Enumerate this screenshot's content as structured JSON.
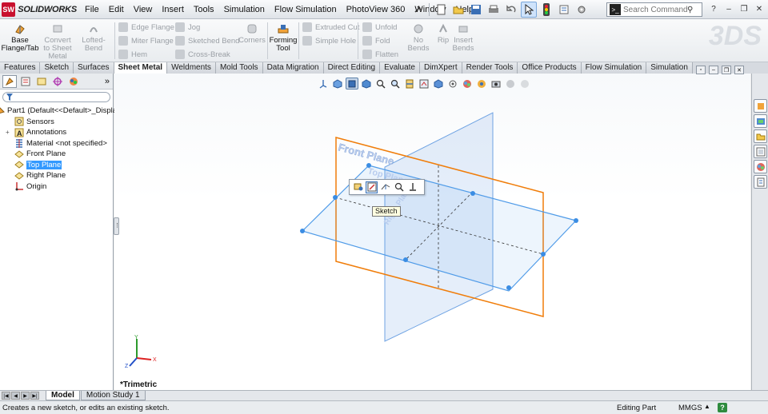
{
  "app": {
    "logo_badge": "SW",
    "logo_name": "SOLIDWORKS",
    "menus": [
      "File",
      "Edit",
      "View",
      "Insert",
      "Tools",
      "Simulation",
      "Flow Simulation",
      "PhotoView 360",
      "Window",
      "Help"
    ],
    "search_placeholder": "Search Commands",
    "watermark": "3DS"
  },
  "ribbon": {
    "base_flange": "Base Flange/Tab",
    "convert": "Convert to Sheet Metal",
    "lofted_bend": "Lofted-Bend",
    "edge_flange": "Edge Flange",
    "miter_flange": "Miter Flange",
    "hem": "Hem",
    "jog": "Jog",
    "sketched_bend": "Sketched Bend",
    "cross_break": "Cross-Break",
    "corners": "Corners",
    "forming_tool": "Forming Tool",
    "extruded_cut": "Extruded Cut",
    "simple_hole": "Simple Hole",
    "unfold": "Unfold",
    "fold": "Fold",
    "flatten": "Flatten",
    "no_bends": "No Bends",
    "rip": "Rip",
    "insert_bends": "Insert Bends"
  },
  "tabs": [
    {
      "label": "Features",
      "active": false
    },
    {
      "label": "Sketch",
      "active": false
    },
    {
      "label": "Surfaces",
      "active": false
    },
    {
      "label": "Sheet Metal",
      "active": true
    },
    {
      "label": "Weldments",
      "active": false
    },
    {
      "label": "Mold Tools",
      "active": false
    },
    {
      "label": "Data Migration",
      "active": false
    },
    {
      "label": "Direct Editing",
      "active": false
    },
    {
      "label": "Evaluate",
      "active": false
    },
    {
      "label": "DimXpert",
      "active": false
    },
    {
      "label": "Render Tools",
      "active": false
    },
    {
      "label": "Office Products",
      "active": false
    },
    {
      "label": "Flow Simulation",
      "active": false
    },
    {
      "label": "Simulation",
      "active": false
    }
  ],
  "feature_tree": {
    "expand_arrow": "»",
    "items": [
      {
        "label": "Part1  (Default<<Default>_Displa",
        "icon": "part-icon",
        "expander": ""
      },
      {
        "label": "Sensors",
        "icon": "sensor-icon",
        "expander": ""
      },
      {
        "label": "Annotations",
        "icon": "annotation-icon",
        "expander": "+"
      },
      {
        "label": "Material <not specified>",
        "icon": "material-icon",
        "expander": ""
      },
      {
        "label": "Front Plane",
        "icon": "plane-icon",
        "expander": ""
      },
      {
        "label": "Top Plane",
        "icon": "plane-icon",
        "expander": "",
        "selected": true
      },
      {
        "label": "Right Plane",
        "icon": "plane-icon",
        "expander": ""
      },
      {
        "label": "Origin",
        "icon": "origin-icon",
        "expander": ""
      }
    ]
  },
  "viewport": {
    "front_plane_label": "Front Plane",
    "top_plane_label": "Top Plane",
    "right_plane_label": "Right Plane",
    "view_name": "*Trimetric",
    "tooltip": "Sketch",
    "axes": {
      "x": "X",
      "y": "Y",
      "z": "Z"
    }
  },
  "bottom_tabs": [
    {
      "label": "Model",
      "active": true
    },
    {
      "label": "Motion Study 1",
      "active": false
    }
  ],
  "status": {
    "message": "Creates a new sketch, or edits an existing sketch.",
    "mode": "Editing Part",
    "units": "MMGS",
    "help": "?"
  },
  "colors": {
    "front_plane": "#f07d0a",
    "top_plane": "#4f9be8",
    "right_plane": "#6fa3e3",
    "selection": "#3399ff"
  }
}
